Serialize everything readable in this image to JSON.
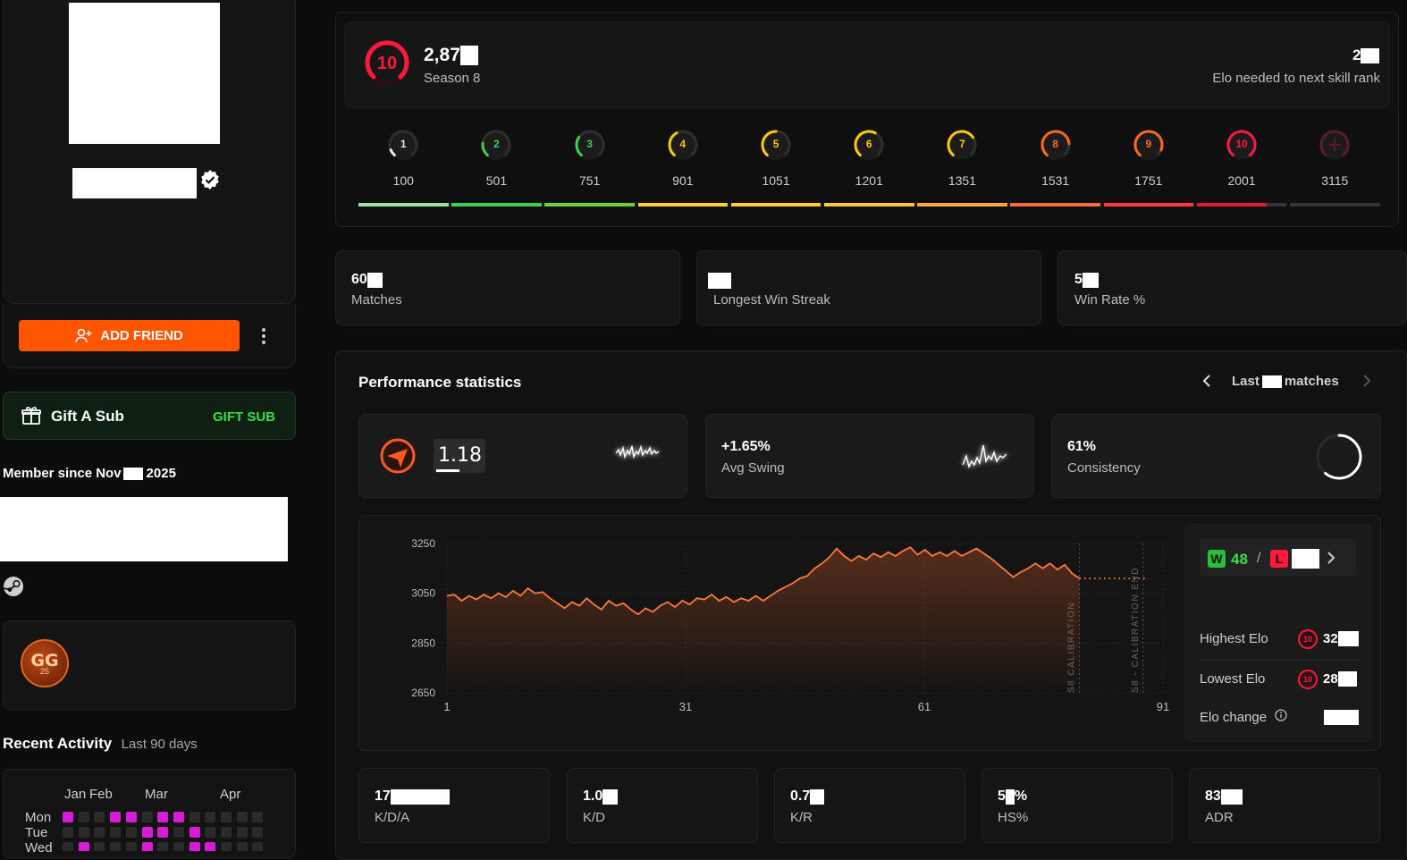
{
  "sidebar": {
    "add_friend": "ADD FRIEND",
    "gift_label": "Gift A Sub",
    "gift_button": "GIFT SUB",
    "member_since_prefix": "Member since Nov",
    "member_since_year": "2025",
    "badge_text": "GG",
    "badge_sub": "25",
    "recent_activity": "Recent Activity",
    "recent_range": "Last 90 days",
    "months": [
      "Jan",
      "Feb",
      "Mar",
      "Apr"
    ],
    "days": [
      "Mon",
      "Tue",
      "Wed"
    ]
  },
  "rank": {
    "level": "10",
    "elo_prefix": "2,87",
    "season": "Season 8",
    "next_prefix": "2",
    "next_label": "Elo needed to next skill rank",
    "levels": [
      {
        "n": "1",
        "elo": "100",
        "color": "#e8e8e8"
      },
      {
        "n": "2",
        "elo": "501",
        "color": "#3fd04a"
      },
      {
        "n": "3",
        "elo": "751",
        "color": "#3fd04a"
      },
      {
        "n": "4",
        "elo": "901",
        "color": "#ffc800"
      },
      {
        "n": "5",
        "elo": "1051",
        "color": "#ffc800"
      },
      {
        "n": "6",
        "elo": "1201",
        "color": "#ffc800"
      },
      {
        "n": "7",
        "elo": "1351",
        "color": "#ffc800"
      },
      {
        "n": "8",
        "elo": "1531",
        "color": "#ff6a1a"
      },
      {
        "n": "9",
        "elo": "1751",
        "color": "#ff6a1a"
      },
      {
        "n": "10",
        "elo": "2001",
        "color": "#ff1a3c"
      },
      {
        "n": "",
        "elo": "3115",
        "color": "#5a1c24"
      }
    ],
    "progress_fraction": 0.78
  },
  "summary": {
    "matches_prefix": "60",
    "matches_label": "Matches",
    "streak_label": "Longest Win Streak",
    "winrate_prefix": "5",
    "winrate_label": "Win Rate %"
  },
  "perf": {
    "title": "Performance statistics",
    "last": "Last",
    "matches": "matches",
    "rating": "1.18",
    "swing_value": "+1.65%",
    "swing_label": "Avg Swing",
    "consistency_value": "61%",
    "consistency_label": "Consistency",
    "consistency_fraction": 0.61
  },
  "wl": {
    "w": "W",
    "wins": "48",
    "sep": "/",
    "l": "L",
    "highest_label": "Highest Elo",
    "highest_prefix": "32",
    "lowest_label": "Lowest Elo",
    "lowest_prefix": "28",
    "change_label": "Elo change",
    "rank_badge": "10"
  },
  "bottom": [
    {
      "prefix": "17",
      "label": "K/D/A"
    },
    {
      "prefix": "1.0",
      "label": "K/D"
    },
    {
      "prefix": "0.7",
      "label": "K/R"
    },
    {
      "prefix": "5",
      "suffix": "%",
      "label": "HS%"
    },
    {
      "prefix": "83",
      "label": "ADR"
    }
  ],
  "chart_data": {
    "type": "line",
    "y_ticks": [
      "3250",
      "3050",
      "2850",
      "2650"
    ],
    "x_ticks": [
      "1",
      "31",
      "61",
      "91"
    ],
    "ylim": [
      2650,
      3250
    ],
    "xlim": [
      1,
      91
    ],
    "annotations": [
      "S8 CALIBRATION",
      "S8 - CALIBRATION END"
    ],
    "x": [
      1,
      2,
      3,
      4,
      5,
      6,
      7,
      8,
      9,
      10,
      11,
      12,
      13,
      14,
      15,
      16,
      17,
      18,
      19,
      20,
      21,
      22,
      23,
      24,
      25,
      26,
      27,
      28,
      29,
      30,
      31,
      32,
      33,
      34,
      35,
      36,
      37,
      38,
      39,
      40,
      41,
      42,
      43,
      44,
      45,
      46,
      47,
      48,
      49,
      50,
      51,
      52,
      53,
      54,
      55,
      56,
      57,
      58,
      59,
      60,
      61,
      62,
      63,
      64,
      65,
      66,
      66,
      67,
      68,
      69,
      70,
      71,
      72,
      73,
      74,
      75,
      76,
      77,
      78,
      79,
      80,
      81,
      82
    ],
    "values": [
      3040,
      3045,
      3020,
      3040,
      3025,
      3045,
      3030,
      3050,
      3035,
      3060,
      3040,
      3070,
      3050,
      3055,
      3030,
      3010,
      2990,
      3015,
      3000,
      3030,
      3005,
      2985,
      3020,
      3000,
      3010,
      2985,
      2965,
      2990,
      2975,
      3000,
      3015,
      2995,
      3020,
      3005,
      3030,
      3025,
      3045,
      3020,
      3035,
      3015,
      3030,
      3020,
      3040,
      3020,
      3040,
      3060,
      3075,
      3090,
      3110,
      3120,
      3150,
      3170,
      3195,
      3230,
      3200,
      3180,
      3200,
      3185,
      3210,
      3195,
      3215,
      3200,
      3220,
      3235,
      3205,
      3225,
      3200,
      3215,
      3200,
      3220,
      3200,
      3215,
      3230,
      3210,
      3190,
      3165,
      3140,
      3115,
      3135,
      3150,
      3170,
      3150,
      3170,
      3145,
      3165,
      3130,
      3110
    ]
  }
}
